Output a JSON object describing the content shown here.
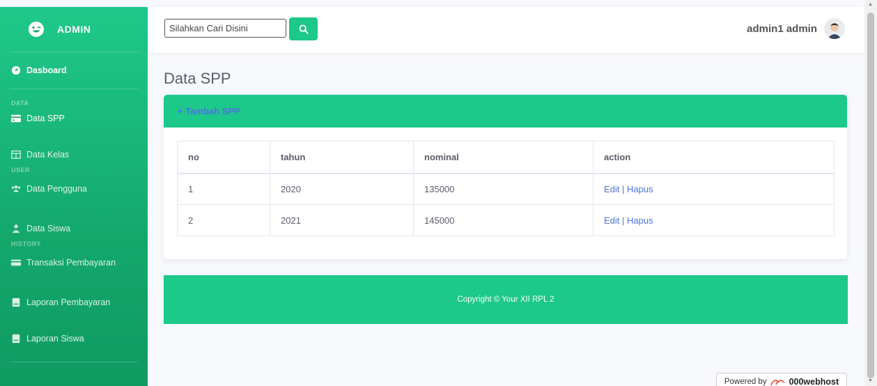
{
  "sidebar": {
    "brand": "ADMIN",
    "dashboard": "Dasboard",
    "sections": {
      "data": "DATA",
      "user": "USER",
      "history": "HISTORY"
    },
    "items": {
      "data_spp": "Data SPP",
      "data_kelas": "Data Kelas",
      "data_pengguna": "Data Pengguna",
      "data_siswa": "Data Siswa",
      "transaksi": "Transaksi Pembayaran",
      "laporan_pembayaran": "Laporan Pembayaran",
      "laporan_siswa": "Laporan Siswa"
    }
  },
  "topbar": {
    "search_placeholder": "Silahkan Cari Disini",
    "user_name": "admin1 admin"
  },
  "page": {
    "title": "Data SPP",
    "add_label": "+ Tambah SPP"
  },
  "table": {
    "headers": [
      "no",
      "tahun",
      "nominal",
      "action"
    ],
    "rows": [
      {
        "no": "1",
        "tahun": "2020",
        "nominal": "135000",
        "edit": "Edit",
        "sep": " | ",
        "hapus": "Hapus"
      },
      {
        "no": "2",
        "tahun": "2021",
        "nominal": "145000",
        "edit": "Edit",
        "sep": " | ",
        "hapus": "Hapus"
      }
    ]
  },
  "footer": {
    "text": "Copyright © Your XII RPL 2"
  },
  "badge": {
    "prefix": "Powered by",
    "brand": "000webhost"
  },
  "colors": {
    "accent": "#1cc88a",
    "link": "#4e73df",
    "text": "#5a5c69"
  }
}
